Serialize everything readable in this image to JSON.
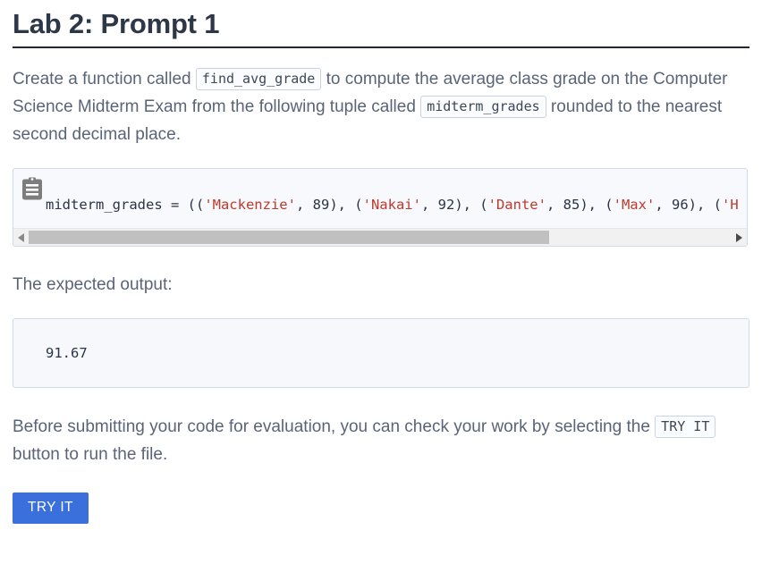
{
  "header": {
    "title": "Lab 2: Prompt 1"
  },
  "intro": {
    "part1": "Create a function called ",
    "code1": "find_avg_grade",
    "part2": " to compute the average class grade on the Computer Science Midterm Exam from the following tuple called ",
    "code2": "midterm_grades",
    "part3": " rounded to the nearest second decimal place."
  },
  "code_block": {
    "copy_icon": "clipboard-icon",
    "language": "python",
    "line_prefix": "midterm_grades = ((",
    "tokens": [
      {
        "str": "'Mackenzie'",
        "sep": ", ",
        "num": "89",
        "close": "), ("
      },
      {
        "str": "'Nakai'",
        "sep": ", ",
        "num": "92",
        "close": "), ("
      },
      {
        "str": "'Dante'",
        "sep": ", ",
        "num": "85",
        "close": "), ("
      },
      {
        "str": "'Max'",
        "sep": ", ",
        "num": "96",
        "close": "), ("
      },
      {
        "str": "'H",
        "sep": "",
        "num": "",
        "close": ""
      }
    ],
    "full_visible_line": "midterm_grades = (('Mackenzie', 89), ('Nakai', 92), ('Dante', 85), ('Max', 96), ('H",
    "scrollbar": {
      "left_arrow": "arrow-left-icon",
      "right_arrow": "arrow-right-icon",
      "thumb_fraction_percent": "74"
    }
  },
  "expected": {
    "label": "The expected output:",
    "value": "91.67"
  },
  "footer": {
    "part1": "Before submitting your code for evaluation, you can check your work by selecting the ",
    "code": "TRY IT",
    "part2": " button to run the file."
  },
  "try_button": {
    "label": "TRY IT",
    "color": "#3b6fdc"
  }
}
